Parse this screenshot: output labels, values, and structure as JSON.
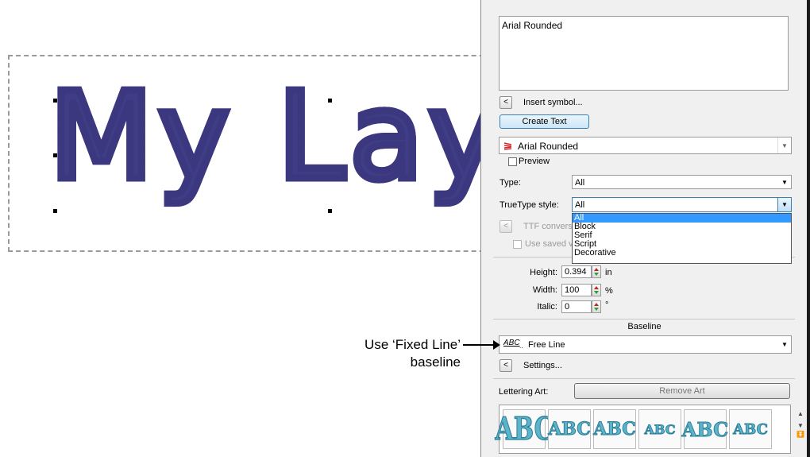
{
  "canvas": {
    "embroidery_text": "My Layo"
  },
  "callout": {
    "line1": "Use ‘Fixed Line’",
    "line2": "baseline"
  },
  "panel": {
    "text_value": "Arial Rounded",
    "insert_symbol_label": "Insert symbol...",
    "insert_symbol_btn": "<",
    "create_text_label": "Create Text",
    "font_combo_value": "Arial Rounded",
    "preview_label": "Preview",
    "type_label": "Type:",
    "type_value": "All",
    "truetype_style_label": "TrueType style:",
    "truetype_style_value": "All",
    "truetype_options": [
      "All",
      "Block",
      "Serif",
      "Script",
      "Decorative"
    ],
    "ttf_conversion_label": "TTF conversi",
    "ttf_btn": "<",
    "use_saved_label": "Use saved ve",
    "height_label": "Height:",
    "height_value": "0.394",
    "height_unit": "in",
    "width_label": "Width:",
    "width_value": "100",
    "width_unit": "%",
    "italic_label": "Italic:",
    "italic_value": "0",
    "italic_unit": "°",
    "baseline_heading": "Baseline",
    "baseline_icon_text": "ABC",
    "baseline_value": "Free Line",
    "settings_btn": "<",
    "settings_label": "Settings...",
    "lettering_art_label": "Lettering Art:",
    "remove_art_label": "Remove Art",
    "art_thumbs": [
      "ABC",
      "ABC",
      "ABC",
      "ABC",
      "ABC",
      "ABC"
    ]
  },
  "colors": {
    "thread": "#3f3d86",
    "selection": "#3399ff",
    "art_fill": "#5bb4c9"
  }
}
